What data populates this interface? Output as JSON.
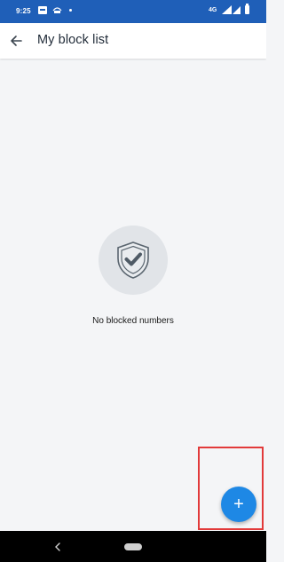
{
  "status_bar": {
    "time": "9:25",
    "network": "4G",
    "bg_color": "#1f5fb8"
  },
  "app_bar": {
    "back_icon": "arrow-left-icon",
    "title": "My block list"
  },
  "empty_state": {
    "icon": "shield-check-icon",
    "message": "No blocked numbers"
  },
  "fab": {
    "icon": "plus-icon",
    "label": "+",
    "color": "#1e88e5"
  },
  "highlight": {
    "color": "#e23a3a"
  },
  "nav_bar": {
    "back_icon": "nav-back-icon",
    "home_icon": "nav-home-pill-icon"
  }
}
